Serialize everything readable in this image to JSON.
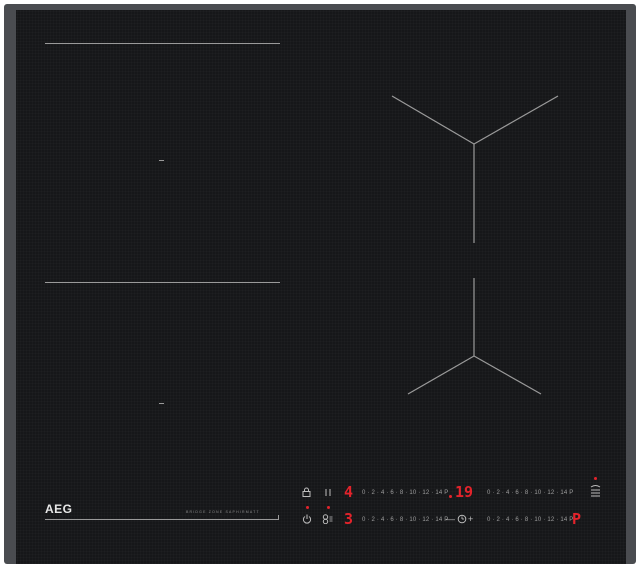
{
  "brand": {
    "name": "AEG",
    "model": "BRIDGE ZONE SAPHIRMATT"
  },
  "left_controls": {
    "lock_icon": "lock-icon",
    "pause_icon": "pause-icon",
    "power_icon": "power-icon",
    "bridge_icon": "bridge-icon"
  },
  "rows": [
    {
      "left_display": "4",
      "left_scale": "0 · 2 · 4 · 6 · 8 · 10 · 12 · 14 P",
      "right_display": "19",
      "right_scale": "0 · 2 · 4 · 6 · 8 · 10 · 12 · 14 P"
    },
    {
      "left_display": "3",
      "left_scale": "0 · 2 · 4 · 6 · 8 · 10 · 12 · 14 P",
      "right_display": "P",
      "right_scale": "0 · 2 · 4 · 6 · 8 · 10 · 12 · 14 P"
    }
  ],
  "timer": {
    "minus": "—",
    "plus": "+",
    "timer_icon": "timer-icon"
  },
  "right_icon": "hob-hood-icon",
  "colors": {
    "glass": "#161719",
    "frame": "#4a4c50",
    "display": "#e3232b",
    "lines": "#9a9a9a"
  }
}
